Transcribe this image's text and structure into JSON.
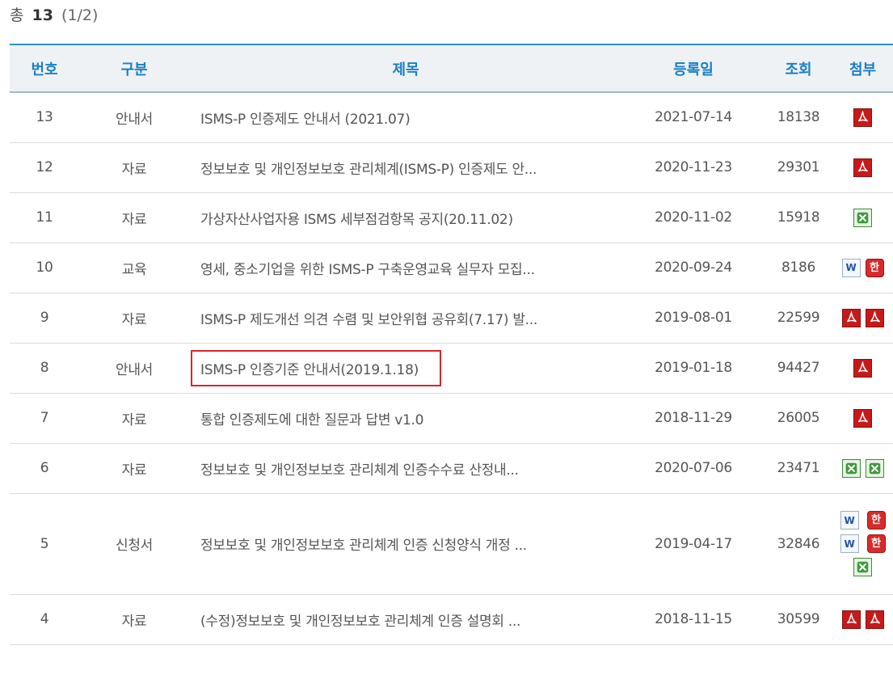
{
  "summary": {
    "prefix": "총",
    "count": "13",
    "pages": "(1/2)"
  },
  "columns": {
    "no": "번호",
    "category": "구분",
    "title": "제목",
    "date": "등록일",
    "views": "조회",
    "attach": "첨부"
  },
  "rows": [
    {
      "no": "13",
      "category": "안내서",
      "title": "ISMS-P 인증제도 안내서 (2021.07)",
      "date": "2021-07-14",
      "views": "18138",
      "attachments": [
        "pdf-icon"
      ]
    },
    {
      "no": "12",
      "category": "자료",
      "title": "정보보호 및 개인정보보호 관리체계(ISMS-P) 인증제도 안...",
      "date": "2020-11-23",
      "views": "29301",
      "attachments": [
        "pdf-icon"
      ]
    },
    {
      "no": "11",
      "category": "자료",
      "title": "가상자산사업자용 ISMS 세부점검항목 공지(20.11.02)",
      "date": "2020-11-02",
      "views": "15918",
      "attachments": [
        "excel-icon"
      ]
    },
    {
      "no": "10",
      "category": "교육",
      "title": "영세, 중소기업을 위한 ISMS-P 구축운영교육 실무자 모집...",
      "date": "2020-09-24",
      "views": "8186",
      "attachments": [
        "word-icon",
        "hwp-icon"
      ]
    },
    {
      "no": "9",
      "category": "자료",
      "title": "ISMS-P 제도개선 의견 수렴 및 보안위협 공유회(7.17) 발...",
      "date": "2019-08-01",
      "views": "22599",
      "attachments": [
        "pdf-icon",
        "pdf-icon"
      ]
    },
    {
      "no": "8",
      "category": "안내서",
      "title": "ISMS-P 인증기준 안내서(2019.1.18)",
      "date": "2019-01-18",
      "views": "94427",
      "attachments": [
        "pdf-icon"
      ],
      "highlighted": true
    },
    {
      "no": "7",
      "category": "자료",
      "title": "통합 인증제도에 대한 질문과 답변 v1.0",
      "date": "2018-11-29",
      "views": "26005",
      "attachments": [
        "pdf-icon"
      ]
    },
    {
      "no": "6",
      "category": "자료",
      "title": "정보보호 및 개인정보보호 관리체계 인증수수료 산정내...",
      "date": "2020-07-06",
      "views": "23471",
      "attachments": [
        "excel-icon",
        "excel-icon"
      ]
    },
    {
      "no": "5",
      "category": "신청서",
      "title": "정보보호 및 개인정보보호 관리체계 인증 신청양식 개정 ...",
      "date": "2019-04-17",
      "views": "32846",
      "attachments": [
        "word-icon",
        "hwp-icon",
        "word-icon",
        "hwp-icon",
        "excel-icon"
      ]
    },
    {
      "no": "4",
      "category": "자료",
      "title": "(수정)정보보호 및 개인정보보호 관리체계 인증 설명회 ...",
      "date": "2018-11-15",
      "views": "30599",
      "attachments": [
        "pdf-icon",
        "pdf-icon"
      ]
    }
  ],
  "colors": {
    "header_text": "#1a7fc4",
    "header_bg": "#eef2f5",
    "highlight_box": "#d9252b"
  }
}
